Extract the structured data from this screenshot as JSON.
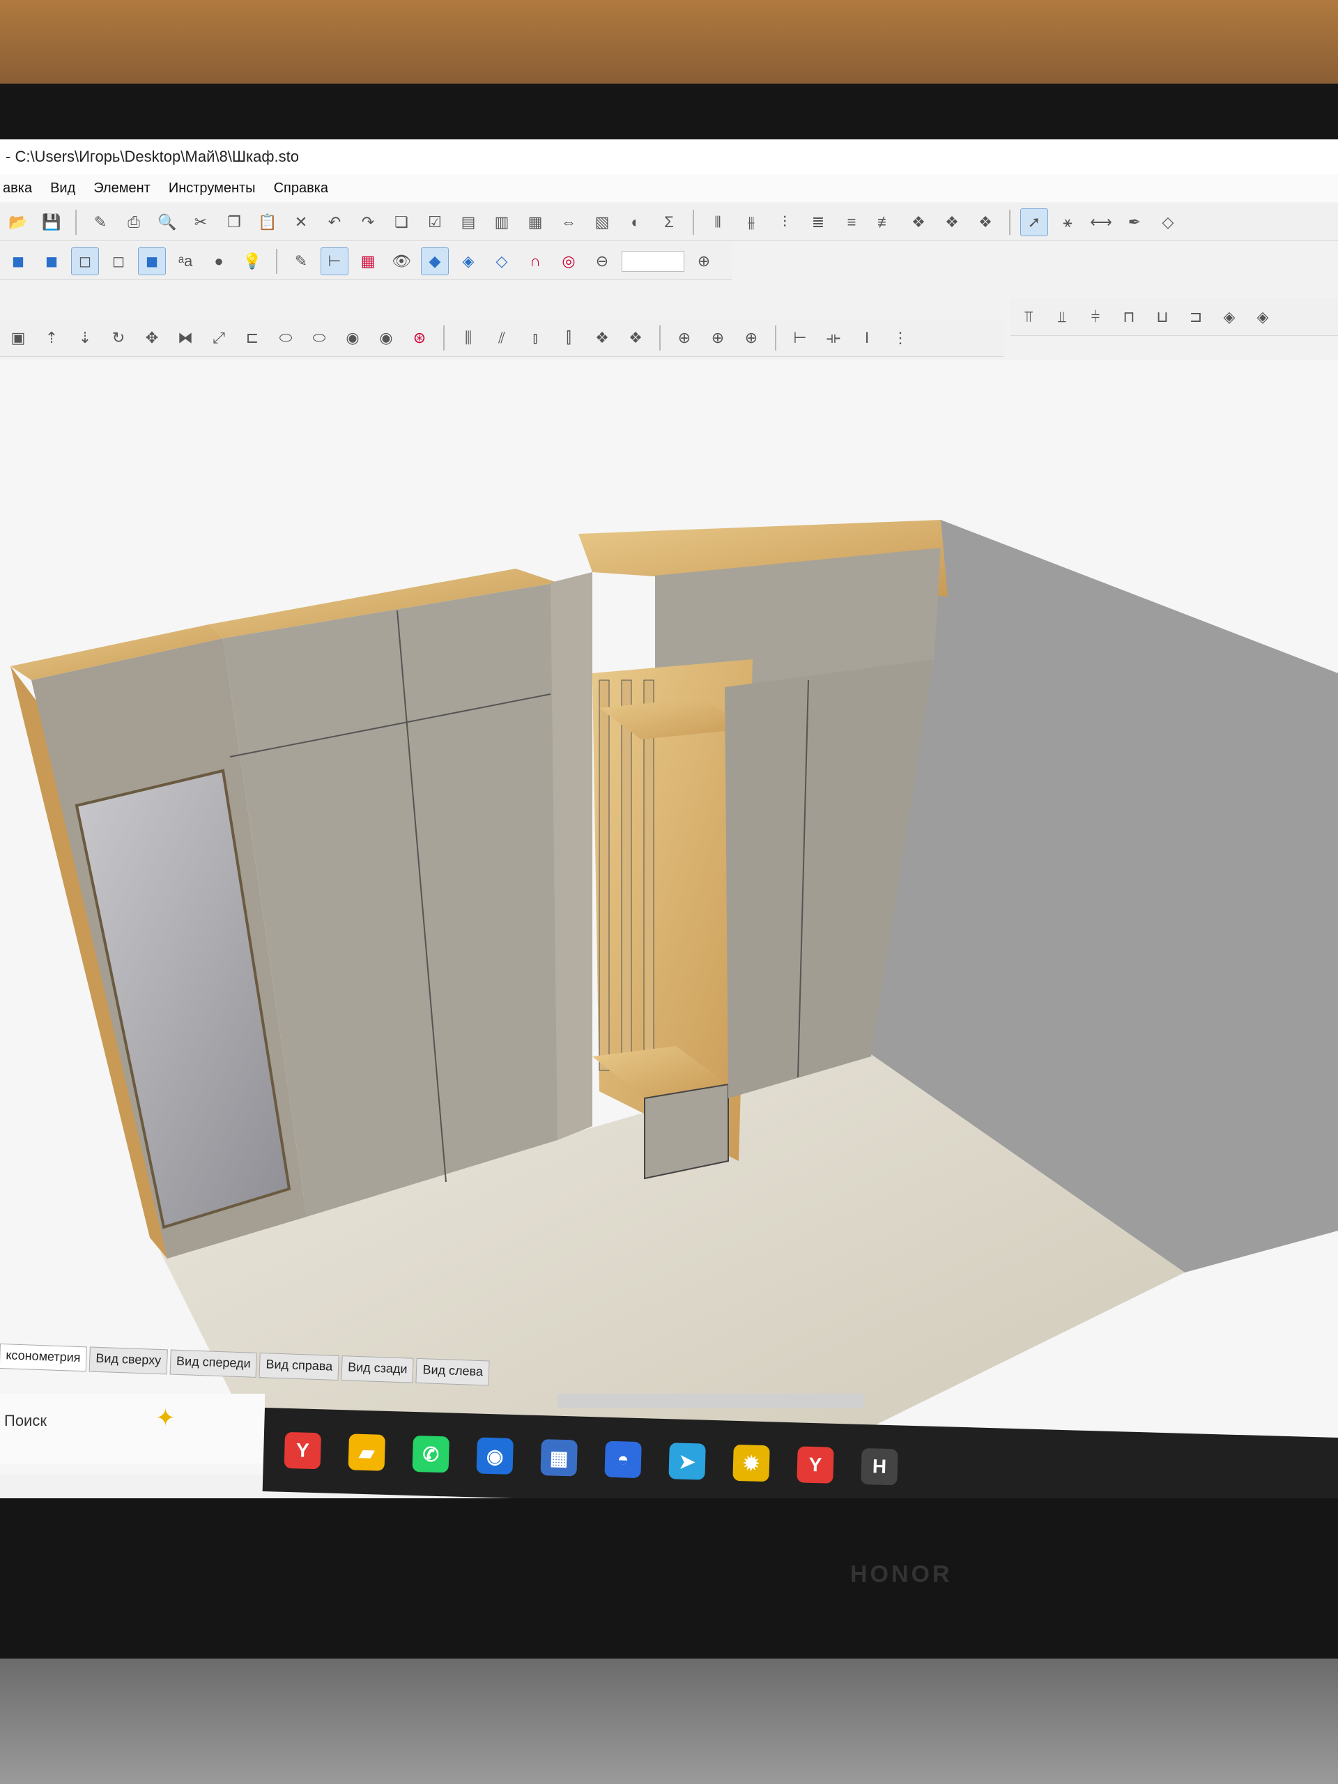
{
  "window": {
    "title": "- C:\\Users\\Игорь\\Desktop\\Май\\8\\Шкаф.sto"
  },
  "menu": [
    "авка",
    "Вид",
    "Элемент",
    "Инструменты",
    "Справка"
  ],
  "toolbar": {
    "row1": [
      "open-icon",
      "save-icon",
      "properties-icon",
      "print-icon",
      "preview-icon",
      "cut-icon",
      "copy-icon",
      "paste-icon",
      "delete-icon",
      "undo-icon",
      "redo-icon",
      "layers-icon",
      "report-icon",
      "table1-icon",
      "table2-icon",
      "table3-icon",
      "table4-icon",
      "table5-icon",
      "table6-icon",
      "sum-icon"
    ],
    "row1_right": [
      "select-arrow-icon",
      "trim-icon",
      "measure-icon",
      "eyedropper-icon",
      "shape-icon"
    ],
    "row2": [
      "cube-solid-icon",
      "cube-shaded-icon",
      "cube-wire-icon",
      "cube-outline-icon",
      "cube-blue-icon",
      "text-aa-icon",
      "material-icon",
      "light-icon",
      "pen-icon",
      "ruler-icon",
      "grid-icon",
      "eye-icon",
      "snap-point-icon",
      "snap-edge-icon",
      "snap-face-icon",
      "magnet-icon",
      "target-icon",
      "zoom-out-icon",
      "zoom-in-icon"
    ],
    "zoom_value": "",
    "sum_symbol": "Σ"
  },
  "view_tabs": [
    "ксонометрия",
    "Вид сверху",
    "Вид спереди",
    "Вид справа",
    "Вид сзади",
    "Вид слева"
  ],
  "selected_tab": 0,
  "search": {
    "label": "Поиск"
  },
  "taskbar": {
    "apps": [
      {
        "name": "yandex-browser-icon",
        "glyph": "Y",
        "color": "#e53935"
      },
      {
        "name": "file-explorer-icon",
        "glyph": "▰",
        "color": "#f4b400"
      },
      {
        "name": "whatsapp-icon",
        "glyph": "✆",
        "color": "#25d366"
      },
      {
        "name": "app-blue-icon",
        "glyph": "◉",
        "color": "#1e6fd9"
      },
      {
        "name": "calculator-icon",
        "glyph": "▦",
        "color": "#3a6fc7"
      },
      {
        "name": "app-cloud-icon",
        "glyph": "◓",
        "color": "#2d6be0"
      },
      {
        "name": "telegram-icon",
        "glyph": "➤",
        "color": "#2aa3df"
      },
      {
        "name": "app-sun-icon",
        "glyph": "✹",
        "color": "#e8b400"
      },
      {
        "name": "yandex-music-icon",
        "glyph": "Y",
        "color": "#e53935"
      },
      {
        "name": "app-h-icon",
        "glyph": "H",
        "color": "#444"
      }
    ]
  },
  "laptop": {
    "brand": "HONOR"
  }
}
